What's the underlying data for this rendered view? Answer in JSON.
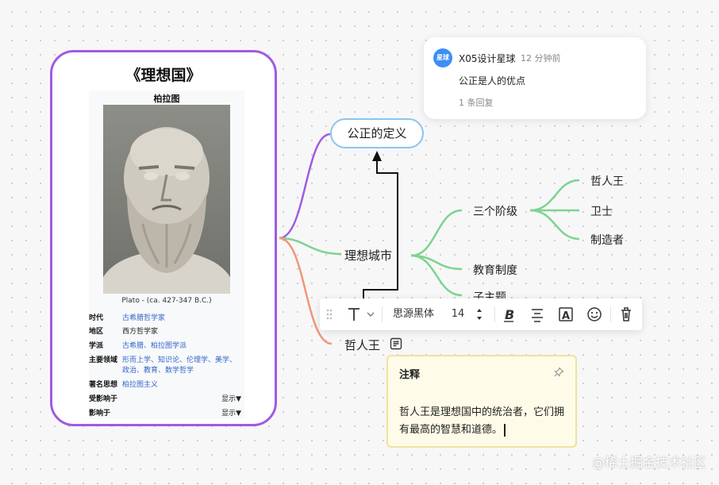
{
  "root": {
    "title": "《理想国》",
    "infobox": {
      "name": "柏拉图",
      "caption": "Plato - (ca. 427-347 B.C.)",
      "rows": [
        {
          "key": "时代",
          "value": "古希腊哲学家"
        },
        {
          "key": "地区",
          "value": "西方哲学家"
        },
        {
          "key": "学派",
          "value": "古希腊、柏拉图学派"
        },
        {
          "key": "主要领域",
          "value": "形而上学、知识论、伦理学、美学、政治、教育、数学哲学"
        },
        {
          "key": "著名思想",
          "value": "柏拉图主义"
        },
        {
          "key": "受影响于",
          "value": "",
          "toggle": "显示▼"
        },
        {
          "key": "影响于",
          "value": "",
          "toggle": "显示▼"
        }
      ]
    }
  },
  "nodes": {
    "justice": "公正的定义",
    "city": "理想城市",
    "classes": "三个阶级",
    "philosopher_king": "哲人王",
    "guardian": "卫士",
    "producer": "制造者",
    "education": "教育制度",
    "subtopic_partial": "子主题",
    "king_branch": "哲人王"
  },
  "comment": {
    "avatar": "星球",
    "user": "X05设计星球",
    "time": "12 分钟前",
    "text": "公正是人的优点",
    "replies": "1 条回复"
  },
  "toolbar": {
    "font_name": "思源黑体",
    "font_size": "14"
  },
  "note": {
    "title": "注释",
    "body": "哲人王是理想国中的统治者，它们拥有最高的智慧和道德。"
  },
  "watermark": "@稀土掘金技术社区",
  "colors": {
    "root_border": "#a05be0",
    "branch_green": "#7dd48f",
    "branch_purple": "#a05be0",
    "branch_orange": "#f0967a",
    "pill_border": "#8cc4f0",
    "note_bg": "#fefce8"
  }
}
